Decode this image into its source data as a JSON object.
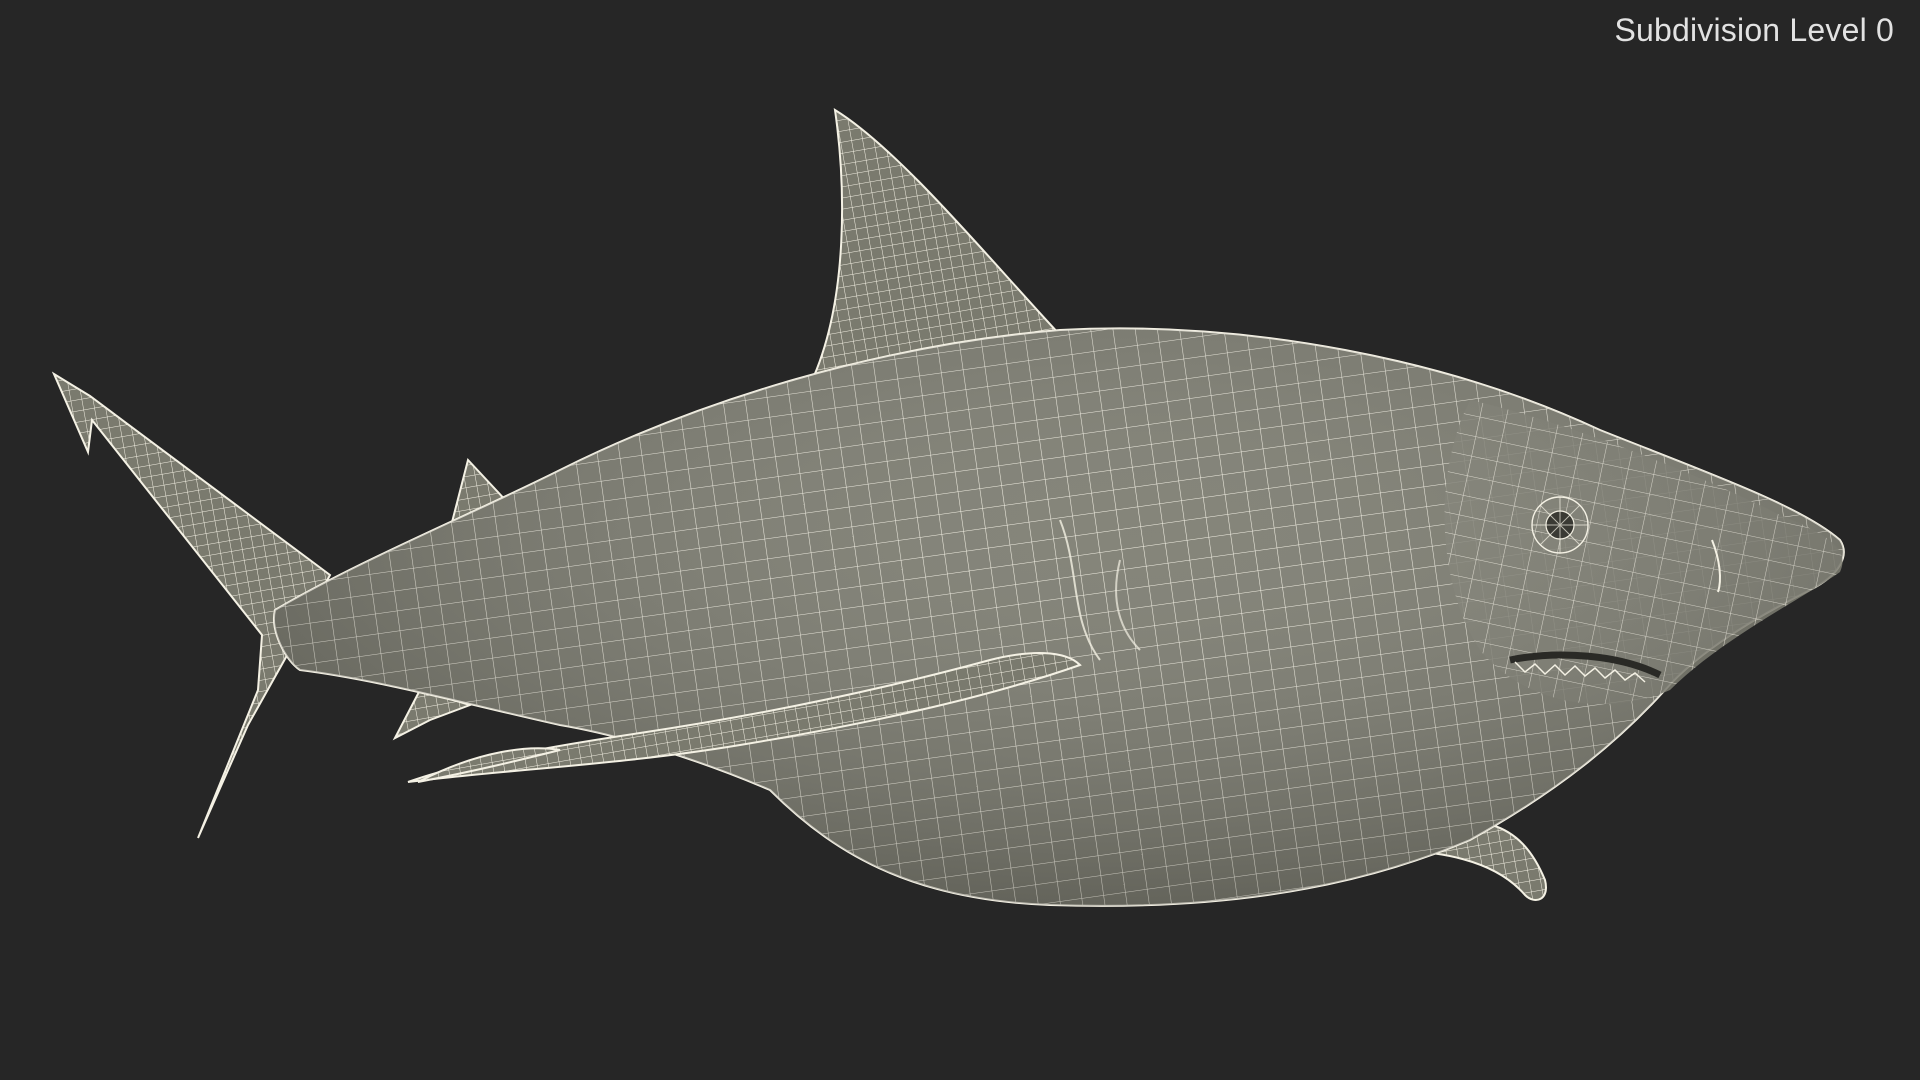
{
  "viewport": {
    "overlay_label": "Subdivision Level 0",
    "background_color": "#262626",
    "text_color": "#e2e2e2"
  },
  "model": {
    "subject": "shark-wireframe",
    "surface_color": "#7a7a6e",
    "wire_color": "#f4f1e4"
  }
}
